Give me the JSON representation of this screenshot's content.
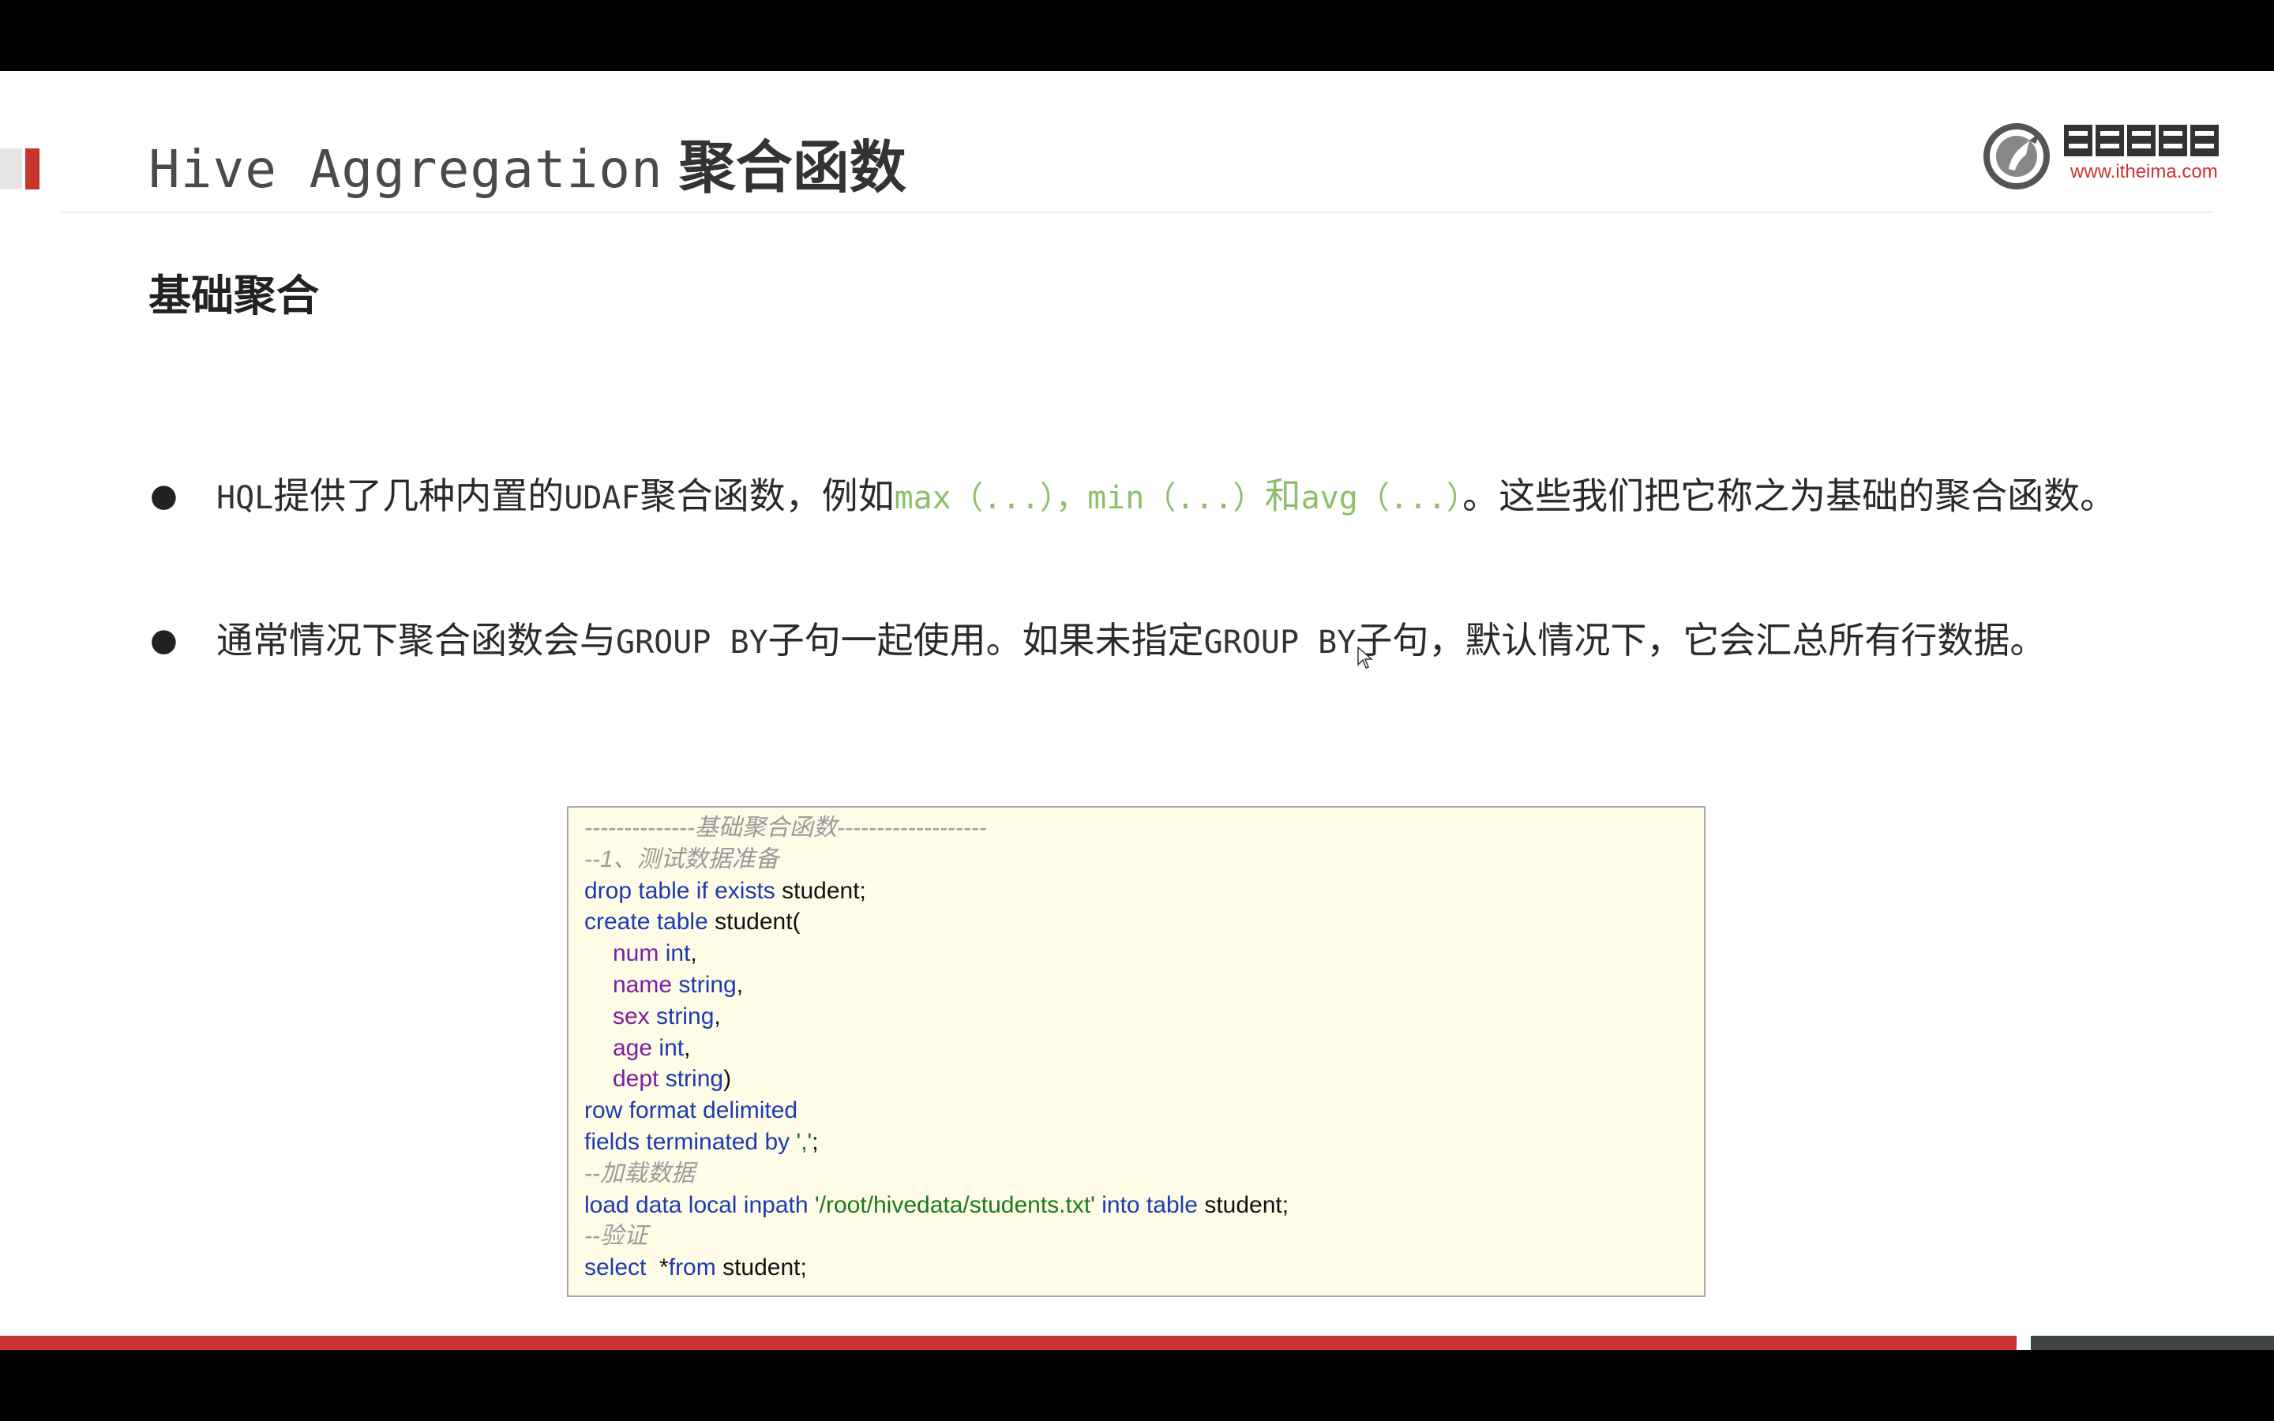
{
  "slide": {
    "title_en": "Hive Aggregation",
    "title_cn": "聚合函数",
    "subtitle": "基础聚合",
    "logo": {
      "icon": "horse-logo-icon",
      "text": "黑马程序员",
      "url": "www.itheima.com"
    }
  },
  "bullets": [
    {
      "p1": "HQL",
      "p2": "提供了几种内置的",
      "p3": "UDAF",
      "p4": "聚合函数，例如",
      "p5": "max（...），min（...）",
      "p6": "和",
      "p7": "avg（...）",
      "p8": "。这些我们把它称之为基础的聚合函数。"
    },
    {
      "p1": "通常情况下聚合函数会与",
      "p2": "GROUP BY",
      "p3": "子句一起使用。如果未指定",
      "p4": "GROUP BY",
      "p5": "子句，默认情况下，它会汇总所有行数据。"
    }
  ],
  "code": {
    "l1": "--------------基础聚合函数-------------------",
    "l2": "--1、测试数据准备",
    "l3_kw": "drop table if exists",
    "l3_id": " student;",
    "l4_kw": "create table",
    "l4_id": " student(",
    "l5_f": "num",
    "l5_t": " int",
    "l5_p": ",",
    "l6_f": "name",
    "l6_t": " string",
    "l6_p": ",",
    "l7_f": "sex",
    "l7_t": " string",
    "l7_p": ",",
    "l8_f": "age",
    "l8_t": " int",
    "l8_p": ",",
    "l9_f": "dept",
    "l9_t": " string",
    "l9_p": ")",
    "l10": "row format delimited",
    "l11_kw": "fields terminated by",
    "l11_s": " ','",
    "l11_p": ";",
    "l12": "--加载数据",
    "l13_kw1": "load data local inpath",
    "l13_s": " '/root/hivedata/students.txt'",
    "l13_kw2": " into table",
    "l13_id": " student;",
    "l14": "--验证",
    "l15_kw1": "select",
    "l15_id1": "  *",
    "l15_kw2": "from",
    "l15_id2": " student;"
  },
  "controls": [
    "previous-icon",
    "next-icon",
    "pen-icon",
    "slides-icon",
    "zoom-icon",
    "more-icon"
  ],
  "progress": {
    "fraction": 0.888
  },
  "colors": {
    "accent": "#c8352f",
    "code_bg": "#fefbe7",
    "keyword": "#1d3bb0",
    "field": "#7b1fa2",
    "string": "#1b7a1b",
    "inline_code": "#8dbf6a"
  }
}
